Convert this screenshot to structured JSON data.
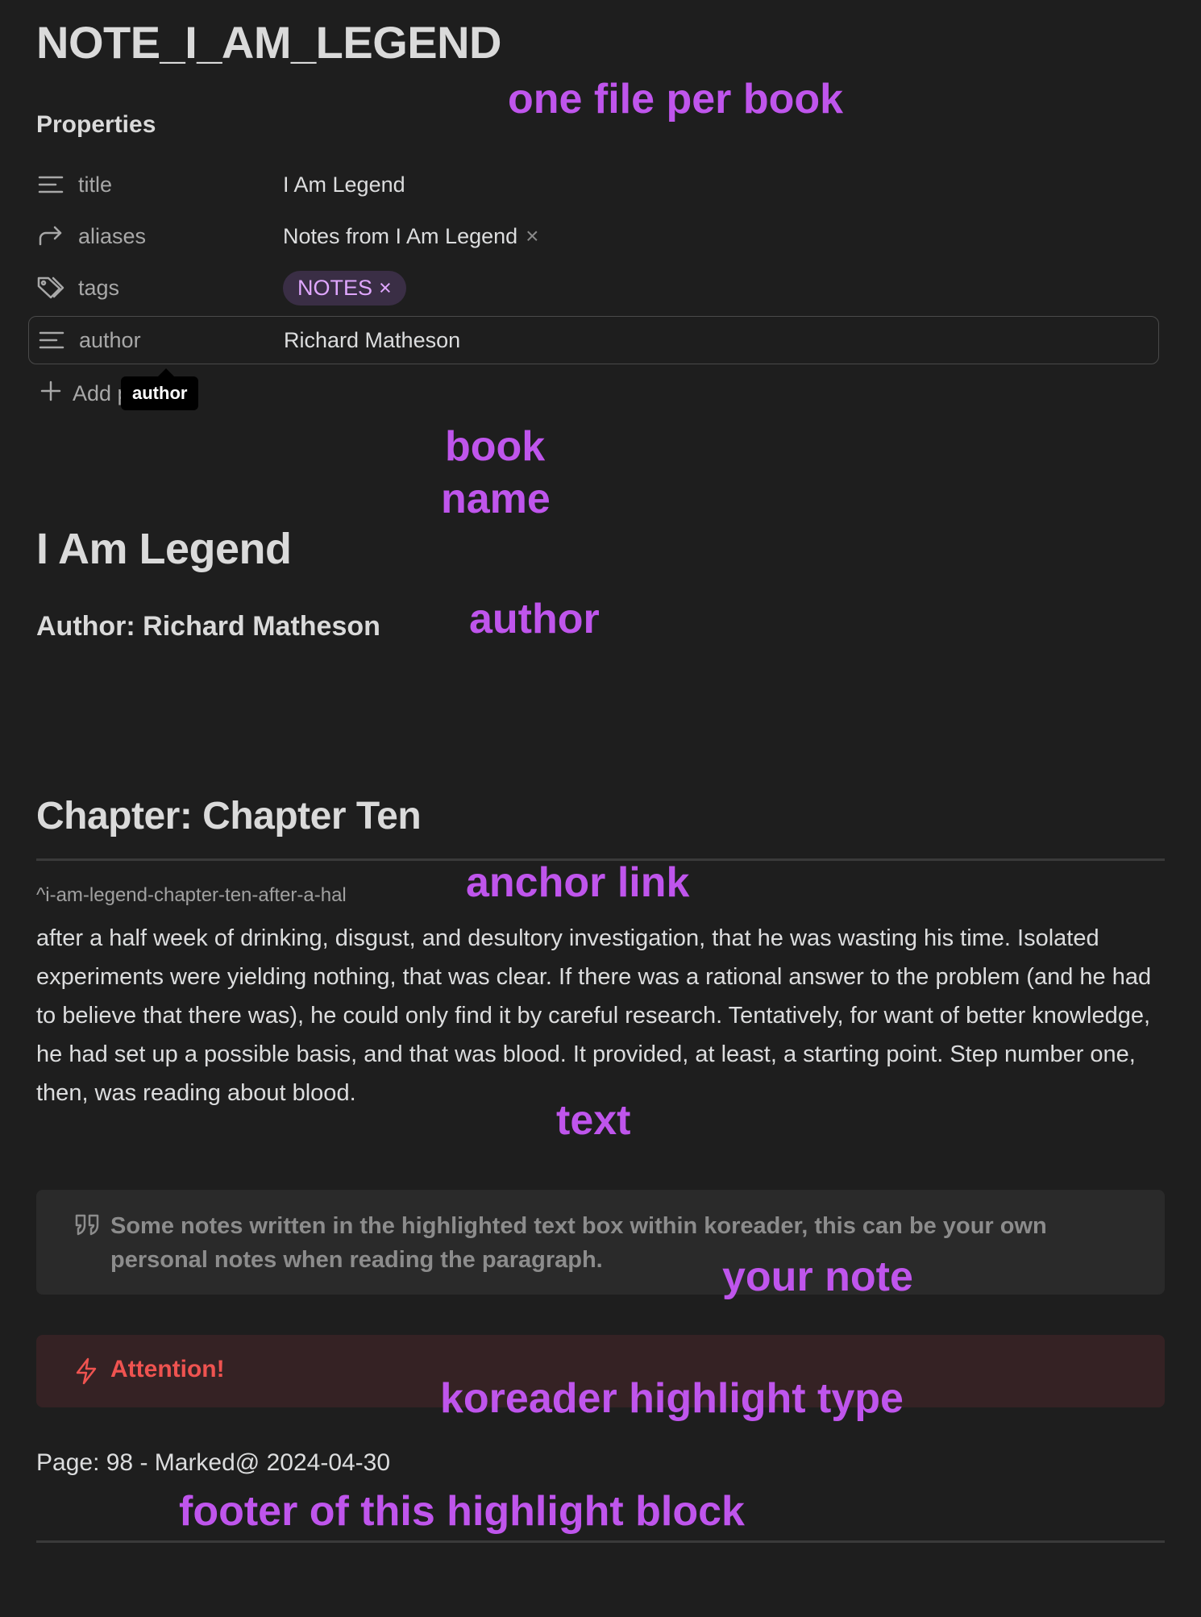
{
  "note_title": "NOTE_I_AM_LEGEND",
  "properties": {
    "heading": "Properties",
    "rows": [
      {
        "key": "title",
        "value": "I Am Legend",
        "icon": "text-lines-icon"
      },
      {
        "key": "aliases",
        "value": "Notes from I Am Legend",
        "remove": "×",
        "icon": "alias-arrow-icon"
      },
      {
        "key": "tags",
        "value": "NOTES",
        "remove": "×",
        "icon": "tag-icon"
      },
      {
        "key": "author",
        "value": "Richard Matheson",
        "icon": "text-lines-icon"
      }
    ],
    "add_label": "Add property",
    "tooltip": "author"
  },
  "book": {
    "title": "I Am Legend",
    "author_line": "Author: Richard Matheson"
  },
  "chapter": {
    "heading": "Chapter: Chapter Ten",
    "anchor": "^i-am-legend-chapter-ten-after-a-hal",
    "text": "after a half week of drinking, disgust, and desultory investigation, that he was wasting his time. Isolated experiments were yielding nothing, that was clear. If there was a rational answer to the problem (and he had to believe that there was), he could only find it by careful research. Tentatively, for want of better knowledge, he had set up a possible basis, and that was blood. It provided, at least, a starting point. Step number one, then, was reading about blood."
  },
  "note_callout": {
    "icon": "quote-icon",
    "text": "Some notes written in the highlighted text box within koreader, this can be your own personal notes when reading the paragraph."
  },
  "attention_callout": {
    "icon": "lightning-icon",
    "text": "Attention!"
  },
  "footer": "Page: 98 - Marked@ 2024-04-30",
  "annotations": {
    "one_file": "one file per book",
    "book_name_1": "book",
    "book_name_2": "name",
    "author": "author",
    "anchor_link": "anchor link",
    "text": "text",
    "your_note": "your note",
    "highlight_type": "koreader highlight type",
    "footer": "footer of this highlight block"
  },
  "colors": {
    "background": "#1e1e1e",
    "annotation": "#bf55ec",
    "tag_bg": "#3a2e45",
    "tag_fg": "#e0a7ff",
    "attention": "#ef5350",
    "attention_bg": "#352224",
    "quote_bg": "#2a2a2a"
  }
}
